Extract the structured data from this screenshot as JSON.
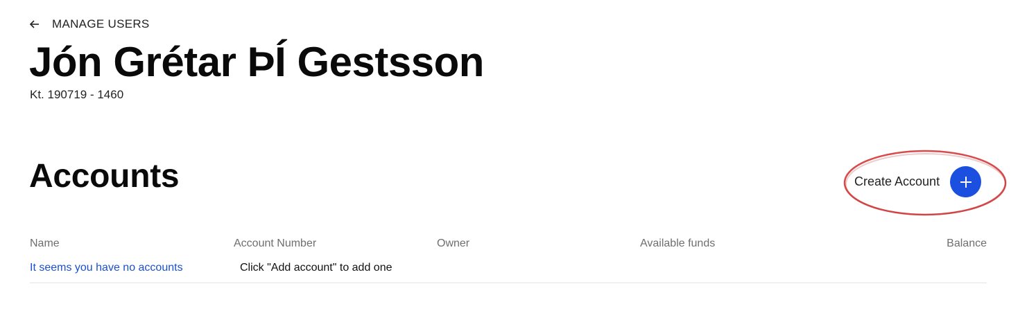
{
  "header": {
    "back_label": "MANAGE USERS",
    "user_name": "Jón Grétar ÞÍ Gestsson",
    "user_id": "Kt. 190719 - 1460"
  },
  "accounts": {
    "title": "Accounts",
    "create_label": "Create Account",
    "columns": [
      "Name",
      "Account Number",
      "Owner",
      "Available funds",
      "Balance"
    ],
    "empty_message": "It seems you have no accounts",
    "empty_hint": "Click \"Add account\" to add one"
  },
  "icons": {
    "back": "arrow-left-icon",
    "create": "plus-icon"
  },
  "colors": {
    "accent": "#1a4fe0",
    "link": "#1a4fd0",
    "highlight": "#d94a4a"
  }
}
